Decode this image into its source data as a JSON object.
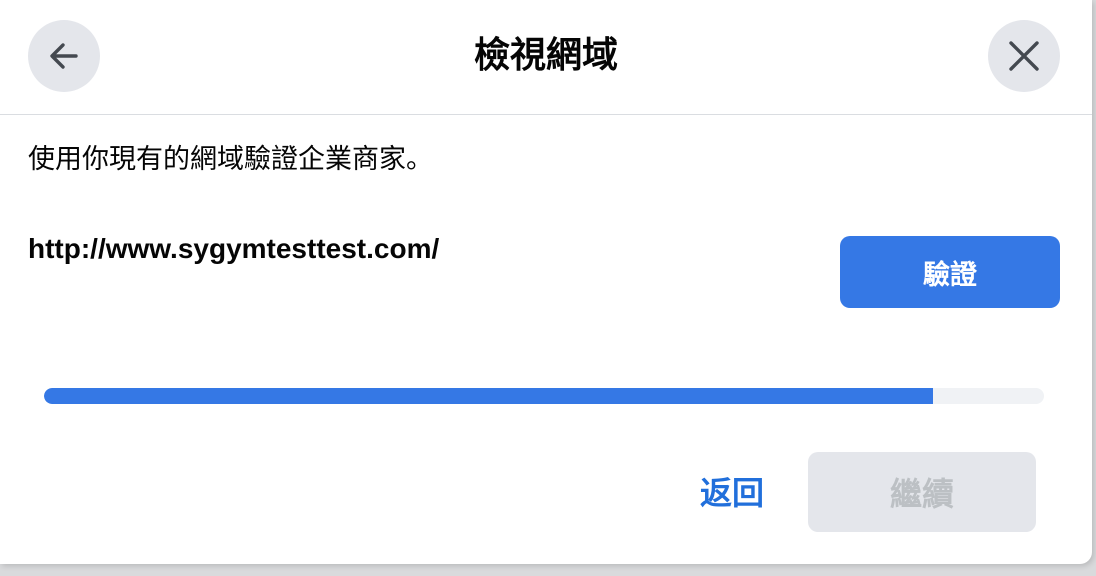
{
  "header": {
    "title": "檢視網域",
    "back_icon": "arrow-left-icon",
    "close_icon": "close-icon"
  },
  "main": {
    "description": "使用你現有的網域驗證企業商家。",
    "domain_url": "http://www.sygymtesttest.com/",
    "verify_label": "驗證"
  },
  "progress": {
    "fraction": 0.889
  },
  "footer": {
    "back_label": "返回",
    "continue_label": "繼續",
    "continue_disabled": true
  },
  "colors": {
    "accent": "#3578e5",
    "link": "#216fdb",
    "disabled_bg": "#e4e6eb",
    "disabled_text": "#bcc0c4"
  }
}
